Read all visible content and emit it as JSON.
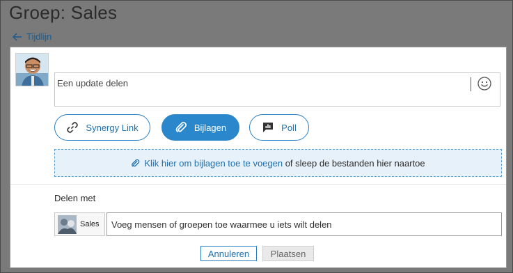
{
  "page": {
    "title": "Groep: Sales"
  },
  "nav": {
    "back_label": "Tijdlijn"
  },
  "composer": {
    "placeholder": "Een update delen"
  },
  "actions": {
    "synergy_link": "Synergy Link",
    "attachments": "Bijlagen",
    "poll": "Poll"
  },
  "dropzone": {
    "link_text": "Klik hier om bijlagen toe te voegen",
    "rest_text": " of sleep de bestanden hier naartoe"
  },
  "share": {
    "label": "Delen met",
    "chip_label": "Sales",
    "input_placeholder": "Voeg mensen of groepen toe waarmee u iets wilt delen"
  },
  "footer": {
    "cancel_label": "Annuleren",
    "post_label": "Plaatsen"
  },
  "colors": {
    "accent": "#2a87cc",
    "link": "#1d6fb0",
    "overlay_bg": "#7a7a7a",
    "dropzone_bg": "#e7f1f9"
  },
  "icons": {
    "back": "arrow-left-icon",
    "emoji": "smiley-icon",
    "link": "chain-link-icon",
    "attach": "paperclip-icon",
    "poll": "poll-icon"
  }
}
